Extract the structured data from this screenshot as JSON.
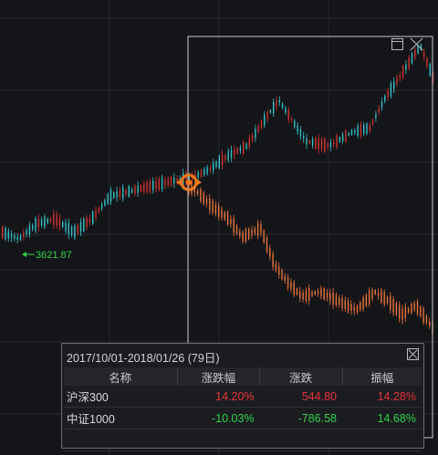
{
  "colors": {
    "up": "#e8333a",
    "down": "#2fd14a",
    "series_a_up": "#d4352f",
    "series_a_down": "#34c4c9",
    "series_b": "#e8743a",
    "marker": "#f07a1a"
  },
  "price_label": "3621.87",
  "range_panel": {
    "window_icon": "window-restore-icon",
    "close_icon": "close-icon"
  },
  "stats": {
    "title": "2017/10/01-2018/01/26 (79日)",
    "close_icon": "close-icon",
    "headers": [
      "名称",
      "涨跌幅",
      "涨跌",
      "振幅"
    ],
    "rows": [
      {
        "name": "沪深300",
        "change_pct": "14.20%",
        "change": "544.80",
        "amplitude": "14.28%"
      },
      {
        "name": "中证1000",
        "change_pct": "-10.03%",
        "change": "-786.58",
        "amplitude": "14.68%"
      }
    ]
  },
  "chart_data": {
    "type": "candlestick",
    "title": "",
    "xlabel": "",
    "ylabel": "",
    "grid": true,
    "annotations": [
      "3621.87"
    ],
    "series": [
      {
        "name": "沪深300",
        "shape": "rising to ~14.20% over selected range"
      },
      {
        "name": "中证1000",
        "shape": "falling to ~-10.03% over selected range"
      }
    ]
  }
}
